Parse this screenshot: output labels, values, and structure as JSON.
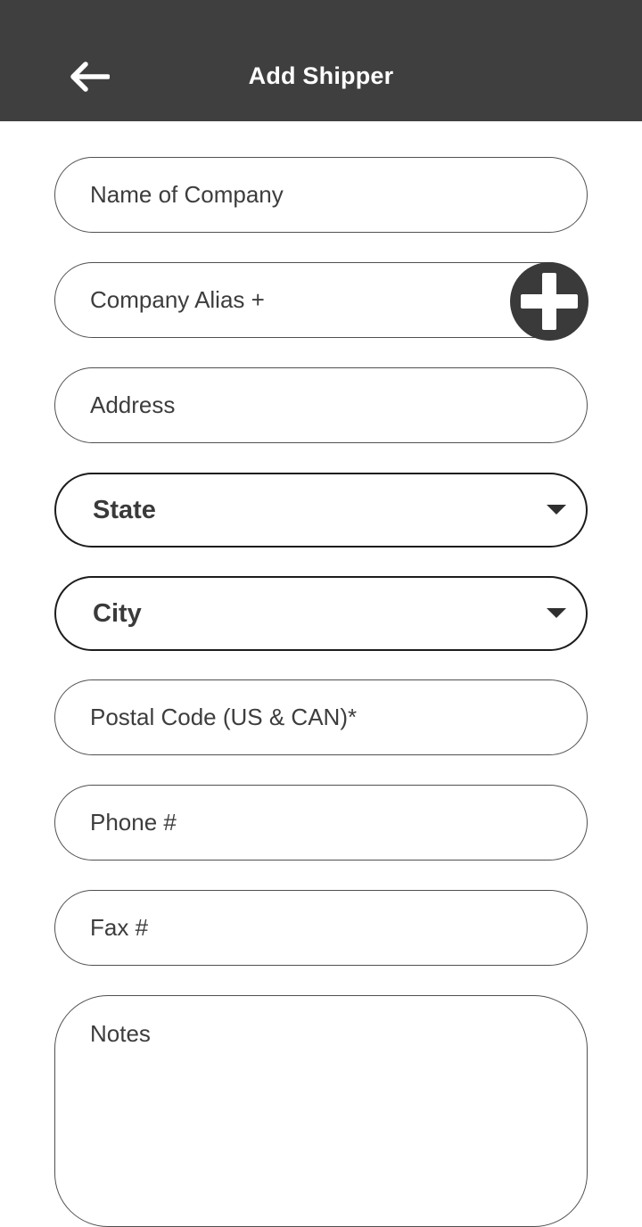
{
  "appbar": {
    "title": "Add Shipper",
    "back_icon": "arrow-left-icon",
    "background": "#3f3f3f"
  },
  "form": {
    "company_name": {
      "placeholder": "Name of Company",
      "value": ""
    },
    "company_alias": {
      "placeholder": "Company Alias +",
      "value": "",
      "add_icon": "plus-circle-icon"
    },
    "address": {
      "placeholder": "Address",
      "value": ""
    },
    "state": {
      "selected": "State",
      "icon": "caret-down-icon"
    },
    "city": {
      "selected": "City",
      "icon": "caret-down-icon"
    },
    "postal_code": {
      "placeholder": "Postal Code (US & CAN)*",
      "value": ""
    },
    "phone": {
      "placeholder": "Phone #",
      "value": ""
    },
    "fax": {
      "placeholder": "Fax #",
      "value": ""
    },
    "notes": {
      "placeholder": "Notes",
      "value": ""
    }
  }
}
